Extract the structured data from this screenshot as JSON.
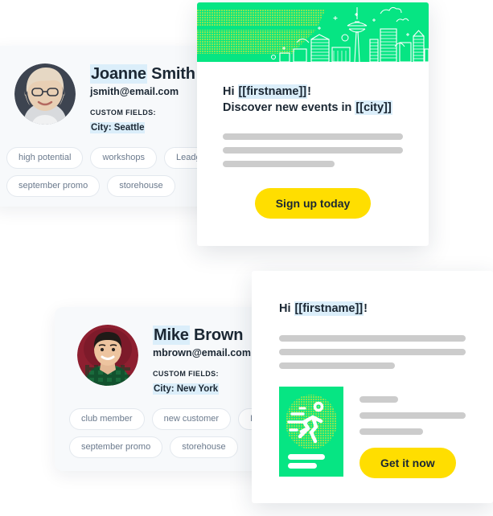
{
  "colors": {
    "brand_green": "#06E583",
    "cta_yellow": "#FFDE00",
    "halftone_yellow": "#F6E52A",
    "card_bg": "#F7F9FB",
    "highlight": "#DBEEFA",
    "bar_gray": "#CCCCCC",
    "text": "#1B2733",
    "tag_text": "#6B7A8D"
  },
  "contacts": [
    {
      "avatar": "avatar-joanne-smith",
      "name_highlighted": "Joanne",
      "name_rest": " Smith",
      "email": "jsmith@email.com",
      "custom_fields_label": "CUSTOM FIELDS:",
      "custom_field_value": "City: Seattle",
      "tag_rows": [
        [
          "high potential",
          "workshops",
          "Leadg"
        ],
        [
          "september promo",
          "storehouse"
        ]
      ]
    },
    {
      "avatar": "avatar-mike-brown",
      "name_highlighted": "Mike",
      "name_rest": " Brown",
      "email": "mbrown@email.com",
      "custom_fields_label": "CUSTOM FIELDS:",
      "custom_field_value": "City: New York",
      "tag_rows": [
        [
          "club member",
          "new customer",
          "Leadg"
        ],
        [
          "september promo",
          "storehouse"
        ]
      ]
    }
  ],
  "emails": [
    {
      "hero": "seattle-skyline-illustration",
      "greeting_prefix": "Hi ",
      "greeting_token": "[[firstname]]",
      "greeting_suffix": "!",
      "subheading_prefix": "Discover new events in ",
      "subheading_token": "[[city]]",
      "body_bars": [
        100,
        100,
        62
      ],
      "cta_label": "Sign up today"
    },
    {
      "greeting_prefix": "Hi ",
      "greeting_token": "[[firstname]]",
      "greeting_suffix": "!",
      "body_bars": [
        100,
        100,
        62
      ],
      "promo_image": "running-person-illustration",
      "promo_bars": [
        36,
        100,
        60
      ],
      "cta_label": "Get it now"
    }
  ]
}
